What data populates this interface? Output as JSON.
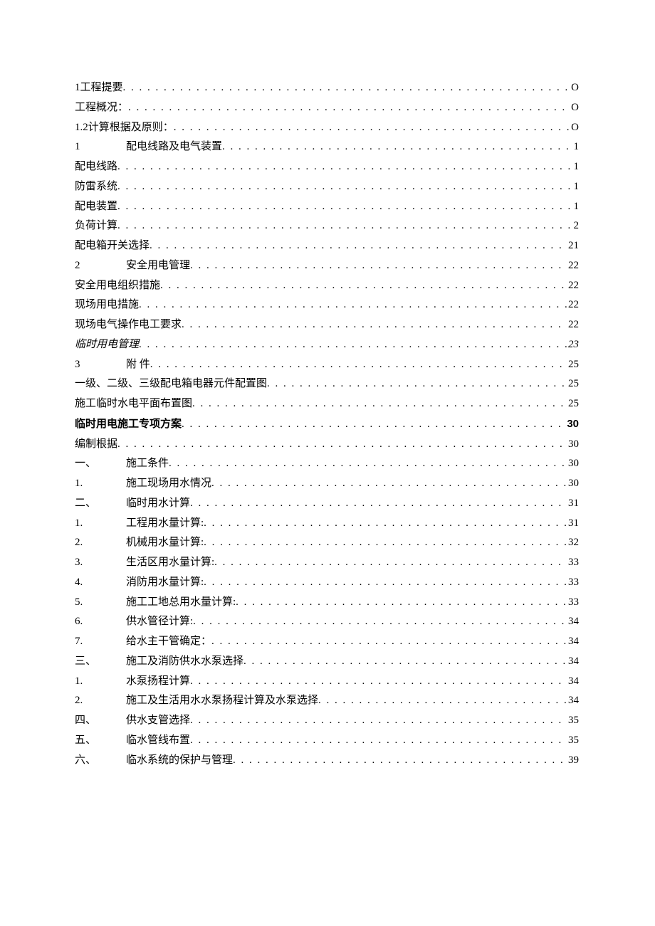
{
  "toc": [
    {
      "num": "",
      "title": "1工程提要",
      "page": "O",
      "bold": false,
      "italic": false
    },
    {
      "num": "",
      "title": "工程概况：",
      "page": "O",
      "bold": false,
      "italic": false
    },
    {
      "num": "",
      "title": "1.2计算根据及原则：",
      "page": "O",
      "bold": false,
      "italic": false
    },
    {
      "num": "1",
      "title": "配电线路及电气装置",
      "page": "1",
      "bold": false,
      "italic": false
    },
    {
      "num": "",
      "title": "配电线路",
      "page": "1",
      "bold": false,
      "italic": false
    },
    {
      "num": "",
      "title": "防雷系统",
      "page": "1",
      "bold": false,
      "italic": false
    },
    {
      "num": "",
      "title": "配电装置",
      "page": "1",
      "bold": false,
      "italic": false
    },
    {
      "num": "",
      "title": "负荷计算",
      "page": "2",
      "bold": false,
      "italic": false
    },
    {
      "num": "",
      "title": "配电箱开关选择",
      "page": "21",
      "bold": false,
      "italic": false
    },
    {
      "num": "2",
      "title": "安全用电管理",
      "page": "22",
      "bold": false,
      "italic": false
    },
    {
      "num": "",
      "title": "安全用电组织措施",
      "page": "22",
      "bold": false,
      "italic": false
    },
    {
      "num": "",
      "title": "现场用电措施",
      "page": "22",
      "bold": false,
      "italic": false
    },
    {
      "num": "",
      "title": "现场电气操作电工要求",
      "page": "22",
      "bold": false,
      "italic": false
    },
    {
      "num": "",
      "title": "临时用电管理",
      "page": "23",
      "bold": false,
      "italic": true
    },
    {
      "num": "3",
      "title": "附 件",
      "page": "25",
      "bold": false,
      "italic": false
    },
    {
      "num": "",
      "title": "一级、二级、三级配电箱电器元件配置图",
      "page": "25",
      "bold": false,
      "italic": false
    },
    {
      "num": "",
      "title": "施工临时水电平面布置图",
      "page": "25",
      "bold": false,
      "italic": false
    },
    {
      "num": "",
      "title": "临时用电施工专项方案",
      "page": "30",
      "bold": true,
      "italic": false
    },
    {
      "num": "",
      "title": "编制根据",
      "page": "30",
      "bold": false,
      "italic": false
    },
    {
      "num": "一、",
      "title": "施工条件",
      "page": "30",
      "bold": false,
      "italic": false
    },
    {
      "num": "1.",
      "title": "施工现场用水情况",
      "page": "30",
      "bold": false,
      "italic": false
    },
    {
      "num": "二、",
      "title": "临时用水计算",
      "page": "31",
      "bold": false,
      "italic": false
    },
    {
      "num": "1.",
      "title": "工程用水量计算:",
      "page": "31",
      "bold": false,
      "italic": false
    },
    {
      "num": "2.",
      "title": "机械用水量计算:",
      "page": "32",
      "bold": false,
      "italic": false
    },
    {
      "num": "3.",
      "title": "生活区用水量计算:",
      "page": "33",
      "bold": false,
      "italic": false
    },
    {
      "num": "4.",
      "title": "消防用水量计算:",
      "page": "33",
      "bold": false,
      "italic": false
    },
    {
      "num": "5.",
      "title": "施工工地总用水量计算:",
      "page": "33",
      "bold": false,
      "italic": false
    },
    {
      "num": "6.",
      "title": "供水管径计算:",
      "page": "34",
      "bold": false,
      "italic": false
    },
    {
      "num": "7.",
      "title": "给水主干管确定：",
      "page": "34",
      "bold": false,
      "italic": false
    },
    {
      "num": "三、",
      "title": "施工及消防供水水泵选择",
      "page": "34",
      "bold": false,
      "italic": false
    },
    {
      "num": "1.",
      "title": "水泵扬程计算",
      "page": "34",
      "bold": false,
      "italic": false
    },
    {
      "num": "2.",
      "title": "施工及生活用水水泵扬程计算及水泵选择",
      "page": "34",
      "bold": false,
      "italic": false
    },
    {
      "num": "四、",
      "title": "供水支管选择",
      "page": "35",
      "bold": false,
      "italic": false
    },
    {
      "num": "五、",
      "title": "临水管线布置",
      "page": "35",
      "bold": false,
      "italic": false
    },
    {
      "num": "六、",
      "title": "临水系统的保护与管理",
      "page": "39",
      "bold": false,
      "italic": false
    }
  ]
}
